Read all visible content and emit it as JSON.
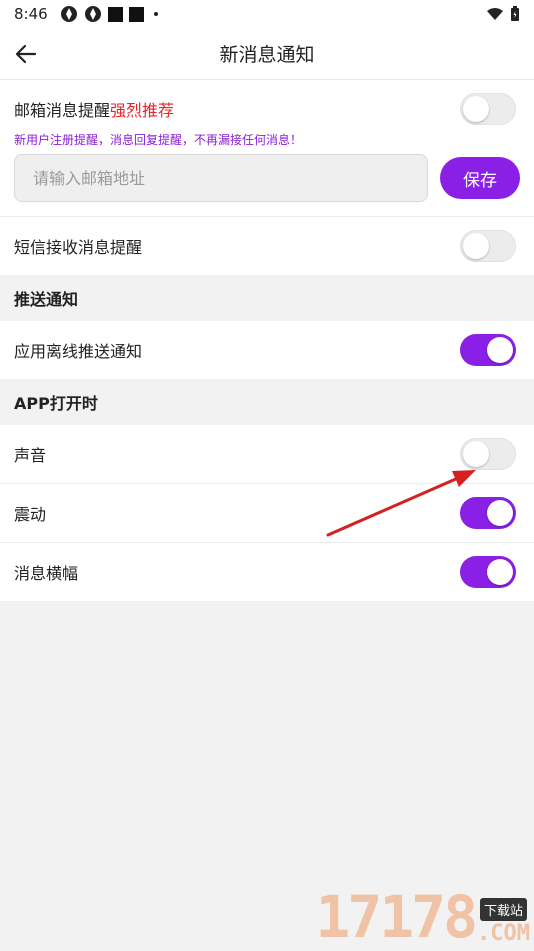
{
  "status_bar": {
    "time": "8:46"
  },
  "app_bar": {
    "title": "新消息通知",
    "back_icon": "arrow-left-icon"
  },
  "email": {
    "label": "邮箱消息提醒",
    "hot_tag": "强烈推荐",
    "hint": "新用户注册提醒，消息回复提醒，不再漏接任何消息！",
    "placeholder": "请输入邮箱地址",
    "value": "",
    "save_label": "保存",
    "toggle_on": false
  },
  "sms": {
    "label": "短信接收消息提醒",
    "toggle_on": false
  },
  "push_section": {
    "header": "推送通知",
    "items": [
      {
        "label": "应用离线推送通知",
        "toggle_on": true
      }
    ]
  },
  "app_open_section": {
    "header": "APP打开时",
    "items": [
      {
        "label": "声音",
        "toggle_on": false
      },
      {
        "label": "震动",
        "toggle_on": true
      },
      {
        "label": "消息横幅",
        "toggle_on": true
      }
    ]
  },
  "watermark": {
    "digits": "17178",
    "tag": "下载站",
    "com": ".COM"
  },
  "colors": {
    "accent": "#8a1fe6",
    "hot": "#e5262a",
    "hint": "#8a1fd6",
    "arrow": "#d42020"
  }
}
